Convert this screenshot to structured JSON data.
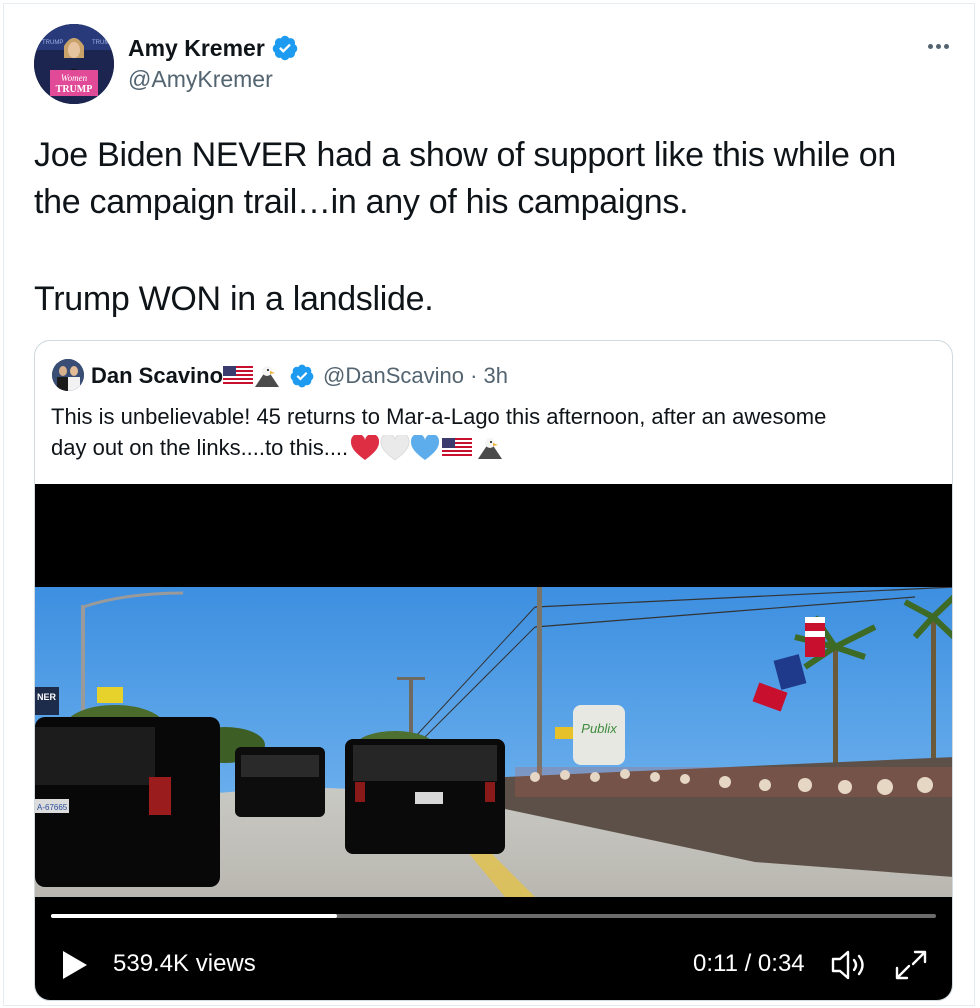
{
  "author": {
    "display_name": "Amy Kremer",
    "handle": "@AmyKremer",
    "avatar_sign_text": "Women TRUMP",
    "verified_color": "#1d9bf0"
  },
  "tweet": {
    "line1": "Joe Biden NEVER had a show of support like this while on",
    "line2": "the campaign trail…in any of his campaigns.",
    "line3": "Trump WON in a landslide."
  },
  "quoted": {
    "display_name": "Dan Scavino",
    "name_emoji": "🇺🇸🦅",
    "handle_time": "@DanScavino · 3h",
    "line1": "This is unbelievable! 45 returns to Mar-a-Lago this afternoon, after an awesome",
    "line2": "day out on the links....to this....",
    "line2_emoji": "❤️🤍💙🇺🇸🦅"
  },
  "video": {
    "views": "539.4K views",
    "time": "0:11 / 0:34",
    "progress_fraction": 0.323,
    "sign_text": "Publix",
    "plate_text": "A-67665",
    "road_sign": "NER"
  },
  "icons": [
    "more-icon",
    "verified-icon",
    "play-icon",
    "volume-icon",
    "expand-icon"
  ],
  "colors": {
    "text": "#0f1419",
    "secondary": "#536471",
    "verified": "#1d9bf0",
    "border": "#cfd9de"
  }
}
